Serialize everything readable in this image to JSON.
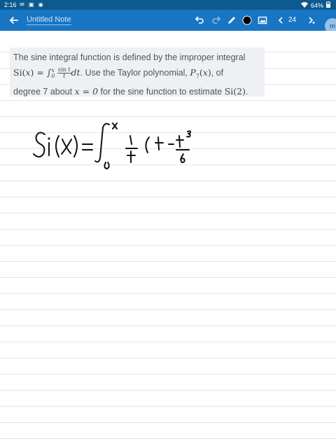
{
  "status": {
    "time": "2:16",
    "battery": "64%"
  },
  "toolbar": {
    "title": "Untitled Note",
    "page_number": "24",
    "pen_color": "#000000",
    "bar_color": "#1976c4",
    "status_color": "#0d5a91"
  },
  "problem": {
    "part1": "The sine integral function is defined by the improper integral",
    "si": "Si",
    "x": "x",
    "eq": " = ∫",
    "lower": "0",
    "upper": "x",
    "sin_t": "sin t",
    "t": "t",
    "dt": "dt",
    "part2": ". Use the Taylor polynomial,",
    "P": "P",
    "seven": "7",
    "part3": ", of",
    "part4": "degree 7 about",
    "xeq0": "x = 0",
    "part5": "for the sine function to estimate",
    "si2": "Si(2)",
    "end": "."
  },
  "handwriting": {
    "description_only": ""
  }
}
